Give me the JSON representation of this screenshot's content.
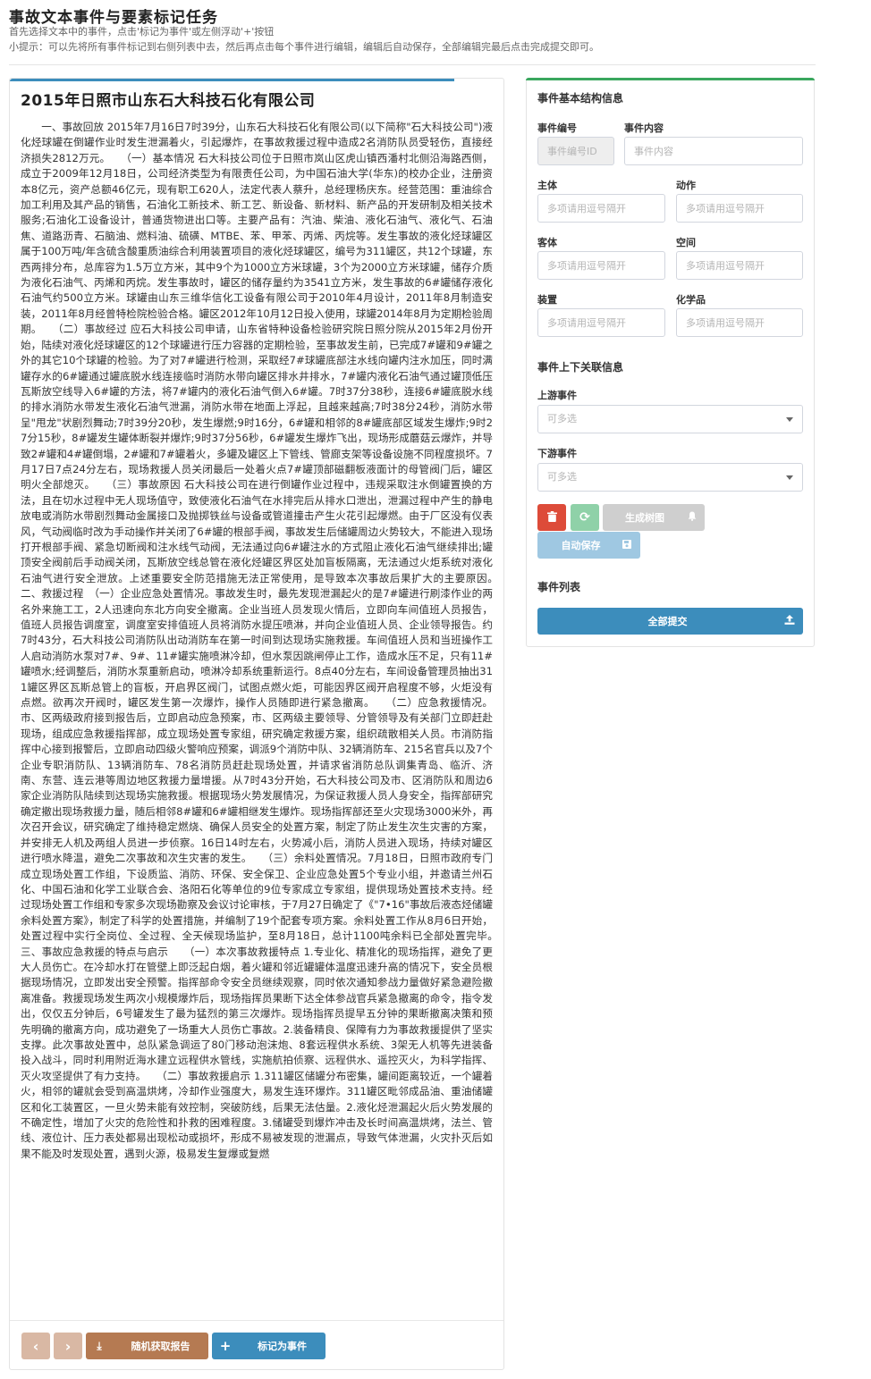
{
  "page": {
    "title": "事故文本事件与要素标记任务",
    "hint1": "首先选择文本中的事件，点击'标记为事件'或左侧浮动'+'按钮",
    "hint2": "小提示：可以先将所有事件标记到右侧列表中去，然后再点击每个事件进行编辑，编辑后自动保存，全部编辑完最后点击完成提交即可。"
  },
  "document": {
    "title": "2015年日照市山东石大科技石化有限公司",
    "body": "一、事故回放 2015年7月16日7时39分，山东石大科技石化有限公司(以下简称\"石大科技公司\")液化烃球罐在倒罐作业时发生泄漏着火，引起爆炸，在事故救援过程中造成2名消防队员受轻伤，直接经济损失2812万元。　　（一）基本情况 石大科技公司位于日照市岚山区虎山镇西潘村北侧沿海路西侧，成立于2009年12月18日，公司经济类型为有限责任公司，为中国石油大学(华东)的校办企业，注册资本8亿元，资产总额46亿元，现有职工620人，法定代表人蔡升，总经理杨庆东。经营范围：重油综合加工利用及其产品的销售，石油化工新技术、新工艺、新设备、新材料、新产品的开发研制及相关技术服务;石油化工设备设计，普通货物进出口等。主要产品有：汽油、柴油、液化石油气、液化气、石油焦、道路沥青、石脑油、燃料油、硫磺、MTBE、苯、甲苯、丙烯、丙烷等。发生事故的液化烃球罐区属于100万吨/年含硫含酸重质油综合利用装置项目的液化烃球罐区，编号为311罐区，共12个球罐，东西两排分布，总库容为1.5万立方米，其中9个为1000立方米球罐，3个为2000立方米球罐，储存介质为液化石油气、丙烯和丙烷。发生事故时，罐区的储存量约为3541立方米，发生事故的6#罐储存液化石油气约500立方米。球罐由山东三维华信化工设备有限公司于2010年4月设计，2011年8月制造安装，2011年8月经曾特检院检验合格。罐区2012年10月12日投入使用，球罐2014年8月为定期检验周期。　　（二）事故经过 应石大科技公司申请，山东省特种设备检验研究院日照分院从2015年2月份开始，陆续对液化烃球罐区的12个球罐进行压力容器的定期检验，至事故发生前，已完成7#罐和9#罐之外的其它10个球罐的检验。为了对7#罐进行检测，采取经7#球罐底部注水线向罐内注水加压，同时满罐存水的6#罐通过罐底脱水线连接临时消防水带向罐区排水井排水，7#罐内液化石油气通过罐顶低压瓦斯放空线导入6#罐的方法，将7#罐内的液化石油气倒入6#罐。7时37分38秒，连接6#罐底脱水线的排水消防水带发生液化石油气泄漏，消防水带在地面上浮起，且越来越高;7时38分24秒，消防水带呈\"甩龙\"状剧烈舞动;7时39分20秒，发生爆燃;9时16分，6#罐和相邻的8#罐底部区域发生爆炸;9时27分15秒，8#罐发生罐体断裂并爆炸;9时37分56秒，6#罐发生爆炸飞出，现场形成蘑菇云爆炸，并导致2#罐和4#罐倒塌，2#罐和7#罐着火，多罐及罐区上下管线、管廊支架等设备设施不同程度损坏。7月17日7点24分左右，现场救援人员关闭最后一处着火点7#罐顶部磁翻板液面计的母管阀门后，罐区明火全部熄灭。　　（三）事故原因 石大科技公司在进行倒罐作业过程中，违规采取注水倒罐置换的方法，且在切水过程中无人现场值守，致使液化石油气在水排完后从排水口泄出，泄漏过程中产生的静电放电或消防水带剧烈舞动金属接口及抛掷铁丝与设备或管道撞击产生火花引起爆燃。由于厂区没有仪表风，气动阀临时改为手动操作并关闭了6#罐的根部手阀，事故发生后储罐周边火势较大，不能进入现场打开根部手阀、紧急切断阀和注水线气动阀，无法通过向6#罐注水的方式阻止液化石油气继续排出;罐顶安全阀前后手动阀关闭，瓦斯放空线总管在液化烃罐区界区处加盲板隔离，无法通过火炬系统对液化石油气进行安全泄放。上述重要安全防范措施无法正常使用，是导致本次事故后果扩大的主要原因。　　二、救援过程　（一）企业应急处置情况。事故发生时，最先发现泄漏起火的是7#罐进行刷漆作业的两名外来施工工，2人迅速向东北方向安全撤离。企业当班人员发现火情后，立即向车间值班人员报告，值班人员报告调度室，调度室安排值班人员将消防水提压喷淋，并向企业值班人员、企业领导报告。约7时43分，石大科技公司消防队出动消防车在第一时间到达现场实施救援。车间值班人员和当班操作工人启动消防水泵对7#、9#、11#罐实施喷淋冷却，但水泵因跳闸停止工作，造成水压不足，只有11#罐喷水;经调整后，消防水泵重新启动，喷淋冷却系统重新运行。8点40分左右，车间设备管理员抽出311罐区界区瓦斯总管上的盲板，开启界区阀门，试图点燃火炬，可能因界区阀开启程度不够，火炬没有点燃。欲再次开阀时，罐区发生第一次爆炸，操作人员随即进行紧急撤离。　　（二）应急救援情况。市、区两级政府接到报告后，立即启动应急预案，市、区两级主要领导、分管领导及有关部门立即赶赴现场，组成应急救援指挥部，成立现场处置专家组，研究确定救援方案，组织疏散相关人员。市消防指挥中心接到报警后，立即启动四级火警响应预案，调派9个消防中队、32辆消防车、215名官兵以及7个企业专职消防队、13辆消防车、78名消防员赶赴现场处置，并请求省消防总队调集青岛、临沂、济南、东营、连云港等周边地区救援力量增援。从7时43分开始，石大科技公司及市、区消防队和周边6家企业消防队陆续到达现场实施救援。根据现场火势发展情况，为保证救援人员人身安全，指挥部研究确定撤出现场救援力量，随后相邻8#罐和6#罐相继发生爆炸。现场指挥部还至火灾现场3000米外，再次召开会议，研究确定了维持稳定燃烧、确保人员安全的处置方案，制定了防止发生次生灾害的方案，并安排无人机及两组人员进一步侦察。16日14时左右，火势减小后，消防人员进入现场，持续对罐区进行喷水降温，避免二次事故和次生灾害的发生。　　（三）余料处置情况。7月18日，日照市政府专门成立现场处置工作组，下设质监、消防、环保、安全保卫、企业应急处置5个专业小组，并邀请兰州石化、中国石油和化学工业联合会、洛阳石化等单位的9位专家成立专家组，提供现场处置技术支持。经过现场处置工作组和专家多次现场勘察及会议讨论审核，于7月27日确定了《\"7•16\"事故后液态烃储罐余料处置方案》，制定了科学的处置措施，并编制了19个配套专项方案。余料处置工作从8月6日开始，处置过程中实行全岗位、全过程、全天候现场监护，至8月18日，总计1100吨余料已全部处置完毕。　　三、事故应急救援的特点与启示　　（一）本次事故救援特点 1.专业化、精准化的现场指挥，避免了更大人员伤亡。在冷却水打在管壁上即泛起白烟，着火罐和邻近罐罐体温度迅速升高的情况下，安全员根据现场情况，立即发出安全预警。指挥部命令安全员继续观察，同时依次通知参战力量做好紧急避险撤离准备。救援现场发生两次小规模爆炸后，现场指挥员果断下达全体参战官兵紧急撤离的命令，指令发出，仅仅五分钟后，6号罐发生了最为猛烈的第三次爆炸。现场指挥员提早五分钟的果断撤离决策和预先明确的撤离方向，成功避免了一场重大人员伤亡事故。2.装备精良、保障有力为事故救援提供了坚实支撑。此次事故处置中，总队紧急调运了80门移动泡沫炮、8套远程供水系统、3架无人机等先进装备投入战斗，同时利用附近海水建立远程供水管线，实施航拍侦察、远程供水、遥控灭火，为科学指挥、灭火攻坚提供了有力支持。　　（二）事故救援启示 1.311罐区储罐分布密集，罐间距离较近，一个罐着火，相邻的罐就会受到高温烘烤，冷却作业强度大，易发生连环爆炸。311罐区毗邻成品油、重油储罐区和化工装置区，一旦火势未能有效控制，突破防线，后果无法估量。2.液化烃泄漏起火后火势发展的不确定性，增加了火灾的危险性和扑救的困难程度。3.储罐受到爆炸冲击及长时间高温烘烤，法兰、管线、液位计、压力表处都易出现松动或损坏，形成不易被发现的泄漏点，导致气体泄漏，火灾扑灭后如果不能及时发现处置，遇到火源，极易发生复爆或复燃"
  },
  "doc_buttons": {
    "prev_icon": "‹",
    "next_icon": "›",
    "random_icon": "⤓",
    "random_label": "随机获取报告",
    "mark_icon": "+",
    "mark_label": "标记为事件"
  },
  "side": {
    "structure_title": "事件基本结构信息",
    "event_id_label": "事件编号",
    "event_id_placeholder": "事件编号ID",
    "event_content_label": "事件内容",
    "event_content_placeholder": "事件内容",
    "subject_label": "主体",
    "subject_placeholder": "多项请用逗号隔开",
    "action_label": "动作",
    "action_placeholder": "多项请用逗号隔开",
    "object_label": "客体",
    "object_placeholder": "多项请用逗号隔开",
    "space_label": "空间",
    "space_placeholder": "多项请用逗号隔开",
    "device_label": "装置",
    "device_placeholder": "多项请用逗号隔开",
    "chemical_label": "化学品",
    "chemical_placeholder": "多项请用逗号隔开",
    "relation_title": "事件上下关联信息",
    "upstream_label": "上游事件",
    "upstream_placeholder": "可多选",
    "downstream_label": "下游事件",
    "downstream_placeholder": "可多选",
    "tree_label": "生成树图",
    "autosave_label": "自动保存",
    "list_title": "事件列表",
    "submit_label": "全部提交"
  },
  "colors": {
    "primary": "#3c8dbc",
    "success_accent": "#3aa75e",
    "danger": "#dd4b39",
    "brown": "#b57a52"
  },
  "icons": {
    "trash": "trash-icon",
    "refresh": "refresh-icon",
    "bell": "bell-icon",
    "save": "save-icon",
    "upload": "upload-icon"
  }
}
